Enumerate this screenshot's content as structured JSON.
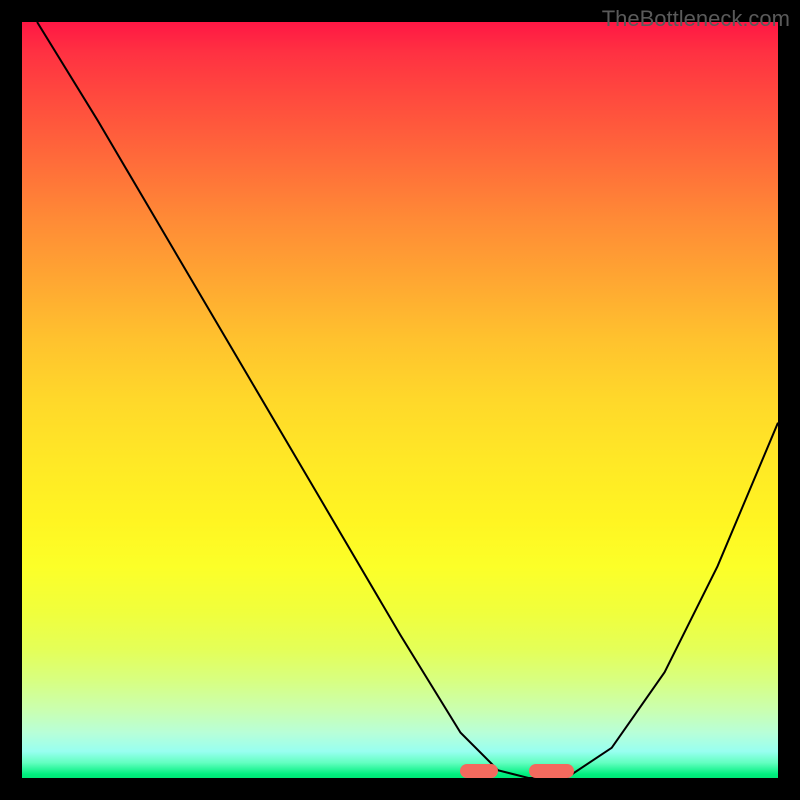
{
  "watermark": "TheBottleneck.com",
  "chart_data": {
    "type": "line",
    "title": "",
    "xlabel": "",
    "ylabel": "",
    "xlim": [
      0,
      100
    ],
    "ylim": [
      0,
      100
    ],
    "series": [
      {
        "name": "curve",
        "x": [
          2,
          10,
          20,
          30,
          40,
          50,
          58,
          63,
          67,
          72,
          78,
          85,
          92,
          100
        ],
        "y": [
          100,
          87,
          70,
          53,
          36,
          19,
          6,
          1,
          0,
          0,
          4,
          14,
          28,
          47
        ]
      }
    ],
    "markers": [
      {
        "name": "optimum-left",
        "x_start": 58,
        "x_end": 63,
        "y": 0
      },
      {
        "name": "optimum-right",
        "x_start": 67,
        "x_end": 73,
        "y": 0
      }
    ],
    "background": "rainbow-gradient"
  },
  "colors": {
    "curve": "#000000",
    "marker": "#f36a5e"
  }
}
